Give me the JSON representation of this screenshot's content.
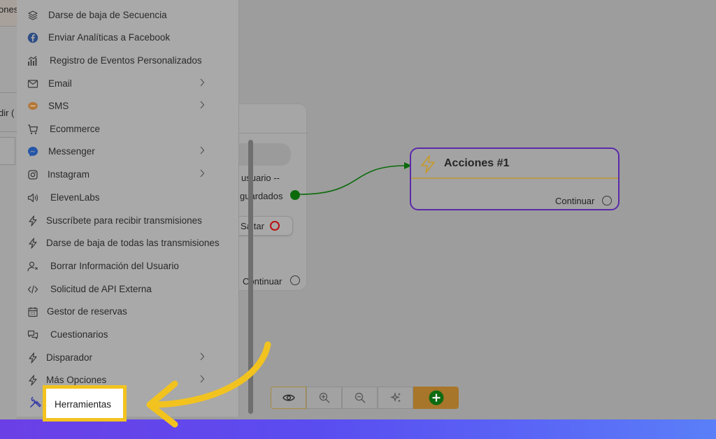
{
  "background": {
    "left_tab_text": "ones",
    "left_text_2": "dir (",
    "card": {
      "line1": "usuario --",
      "line2": "guardados",
      "skip_label": "Saltar",
      "continue_label": "Continuar"
    },
    "actions_node": {
      "title": "Acciones #1",
      "continue_label": "Continuar",
      "icon": "lightning-icon"
    }
  },
  "menu": {
    "items": [
      {
        "label": "Darse de baja de Secuencia",
        "icon": "layers-icon",
        "submenu": false
      },
      {
        "label": "Enviar Analíticas a Facebook",
        "icon": "facebook-icon",
        "submenu": false
      },
      {
        "label": "Registro de Eventos Personalizados",
        "icon": "chart-icon",
        "submenu": false
      },
      {
        "label": "Email",
        "icon": "mail-icon",
        "submenu": true
      },
      {
        "label": "SMS",
        "icon": "sms-icon",
        "submenu": true
      },
      {
        "label": "Ecommerce",
        "icon": "cart-icon",
        "submenu": false
      },
      {
        "label": "Messenger",
        "icon": "messenger-icon",
        "submenu": true
      },
      {
        "label": "Instagram",
        "icon": "instagram-icon",
        "submenu": true
      },
      {
        "label": "ElevenLabs",
        "icon": "speaker-icon",
        "submenu": false
      },
      {
        "label": "Suscríbete para recibir transmisiones",
        "icon": "lightning-icon",
        "submenu": false
      },
      {
        "label": "Darse de baja de todas las transmisiones",
        "icon": "lightning-icon",
        "submenu": false
      },
      {
        "label": "Borrar Información del Usuario",
        "icon": "user-remove-icon",
        "submenu": false
      },
      {
        "label": "Solicitud de API Externa",
        "icon": "code-icon",
        "submenu": false
      },
      {
        "label": "Gestor de reservas",
        "icon": "calendar-icon",
        "submenu": false
      },
      {
        "label": "Cuestionarios",
        "icon": "chat-icon",
        "submenu": false
      },
      {
        "label": "Disparador",
        "icon": "lightning-icon",
        "submenu": true
      },
      {
        "label": "Más Opciones",
        "icon": "lightning-icon",
        "submenu": true
      }
    ],
    "highlighted": {
      "label": "Herramientas",
      "icon": "tools-icon"
    }
  },
  "toolbar": {
    "buttons": [
      "eye-icon",
      "zoom-in-icon",
      "zoom-out-icon",
      "magic-icon",
      "add-icon"
    ]
  },
  "colors": {
    "highlight": "#f2c31f",
    "node_border": "#5b2aa8",
    "connector": "#0b6b0b",
    "add_button": "#a7762a"
  }
}
